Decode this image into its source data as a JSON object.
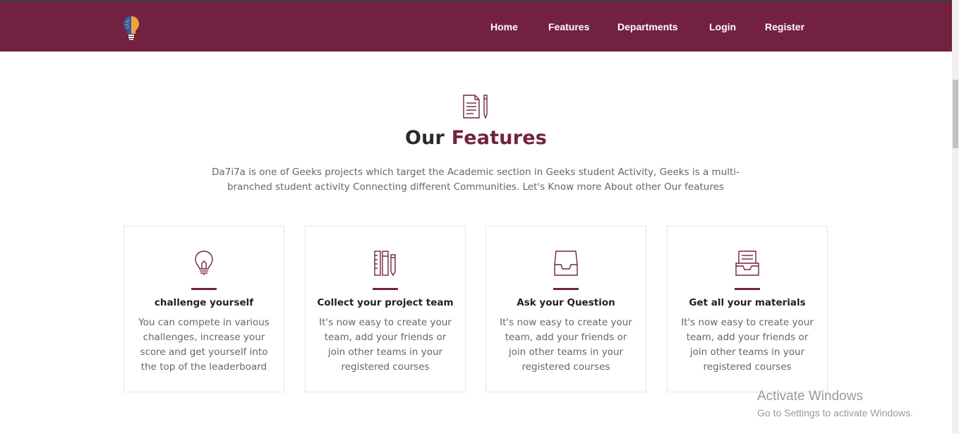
{
  "nav": {
    "logo_icon": "lightbulb-brain-logo",
    "links": [
      {
        "label": "Home"
      },
      {
        "label": "Features"
      },
      {
        "label": "Departments"
      },
      {
        "label": "Login"
      },
      {
        "label": "Register"
      }
    ]
  },
  "features": {
    "icon": "document-pencil-icon",
    "title_prefix": "Our",
    "title_accent": "Features",
    "description": "Da7i7a is one of Geeks projects which target the Academic section in Geeks student Activity, Geeks is a multi-branched student activity Connecting different Communities. Let's Know more About other Our features",
    "cards": [
      {
        "icon": "lightbulb-icon",
        "title": "challenge yourself",
        "text": "You can compete in various challenges, increase your score and get yourself into the top of the leaderboard"
      },
      {
        "icon": "tools-icon",
        "title": "Collect your project team",
        "text": "It's now easy to create your team, add your friends or join other teams in your registered courses"
      },
      {
        "icon": "inbox-tray-icon",
        "title": "Ask your Question",
        "text": "It's now easy to create your team, add your friends or join other teams in your registered courses"
      },
      {
        "icon": "archive-tray-icon",
        "title": "Get all your materials",
        "text": "It's now easy to create your team, add your friends or join other teams in your registered courses"
      }
    ]
  },
  "watermark": {
    "title": "Activate Windows",
    "subtitle": "Go to Settings to activate Windows."
  },
  "colors": {
    "brand": "#722240",
    "logo_blue": "#2f5aa8",
    "logo_orange": "#f2a23a"
  }
}
